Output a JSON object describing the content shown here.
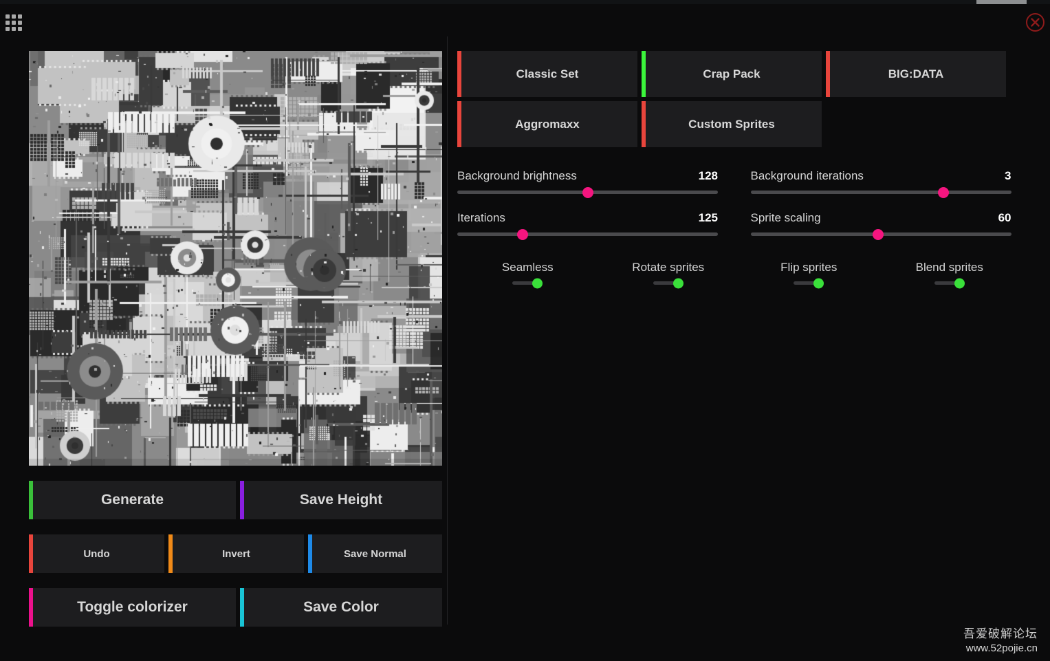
{
  "window": {
    "apps_icon": "apps-grid-icon",
    "close_icon": "close-circle-icon"
  },
  "presets": {
    "row1": [
      {
        "label": "Classic Set",
        "accent": "#e8453c",
        "active": false
      },
      {
        "label": "Crap Pack",
        "accent": "#3bf53b",
        "active": true
      },
      {
        "label": "BIG:DATA",
        "accent": "#e8453c",
        "active": false
      }
    ],
    "row2": [
      {
        "label": "Aggromaxx",
        "accent": "#e8453c",
        "active": false
      },
      {
        "label": "Custom Sprites",
        "accent": "#e8453c",
        "active": false
      }
    ]
  },
  "sliders": [
    {
      "label": "Background brightness",
      "value": "128",
      "percent": 50
    },
    {
      "label": "Background iterations",
      "value": "3",
      "percent": 74
    },
    {
      "label": "Iterations",
      "value": "125",
      "percent": 25
    },
    {
      "label": "Sprite scaling",
      "value": "60",
      "percent": 49
    }
  ],
  "toggles": [
    {
      "label": "Seamless",
      "state": "on"
    },
    {
      "label": "Rotate sprites",
      "state": "on"
    },
    {
      "label": "Flip sprites",
      "state": "on"
    },
    {
      "label": "Blend sprites",
      "state": "on"
    }
  ],
  "actions": {
    "row1": [
      {
        "label": "Generate",
        "accent": "#3ac03a",
        "size": "big"
      },
      {
        "label": "Save Height",
        "accent": "#8a1fe0",
        "size": "big"
      }
    ],
    "row2": [
      {
        "label": "Undo",
        "accent": "#e8453c",
        "size": "small"
      },
      {
        "label": "Invert",
        "accent": "#f08a18",
        "size": "small"
      },
      {
        "label": "Save Normal",
        "accent": "#1e8ae8",
        "size": "small"
      }
    ],
    "row3": [
      {
        "label": "Toggle colorizer",
        "accent": "#ec118c",
        "size": "big"
      },
      {
        "label": "Save Color",
        "accent": "#19c4d6",
        "size": "big"
      }
    ]
  },
  "watermark": {
    "line1": "吾爱破解论坛",
    "line2": "www.52pojie.cn"
  },
  "colors": {
    "accent_slider": "#f4157f",
    "accent_toggle": "#3ae03a",
    "panel": "#1d1d1f",
    "background": "#0b0b0c"
  }
}
